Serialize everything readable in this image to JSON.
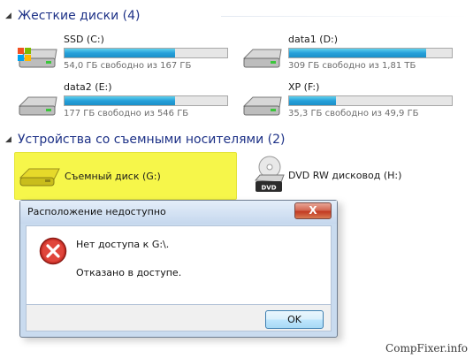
{
  "hard_drives_group": {
    "title": "Жесткие диски (4)",
    "drives": [
      {
        "name": "SSD (C:)",
        "free_text": "54,0 ГБ свободно из 167 ГБ",
        "used_fraction": 0.68
      },
      {
        "name": "data1 (D:)",
        "free_text": "309 ГБ свободно из 1,81 ТБ",
        "used_fraction": 0.84
      },
      {
        "name": "data2 (E:)",
        "free_text": "177 ГБ свободно из 546 ГБ",
        "used_fraction": 0.68
      },
      {
        "name": "XP (F:)",
        "free_text": "35,3 ГБ свободно из 49,9 ГБ",
        "used_fraction": 0.29
      }
    ]
  },
  "removable_group": {
    "title": "Устройства со съемными носителями (2)",
    "devices": [
      {
        "name": "Съемный диск (G:)"
      },
      {
        "name": "DVD RW дисковод (H:)",
        "badge": "DVD"
      }
    ]
  },
  "dialog": {
    "title": "Расположение недоступно",
    "close_label": "X",
    "message": "Нет доступа к G:\\.",
    "detail": "Отказано в доступе.",
    "ok_label": "OK"
  },
  "watermark": "CompFixer.info",
  "colors": {
    "group_header": "#1e3287",
    "bar_fill": "#26a0da",
    "highlight": "#f6f64a",
    "error_red": "#c8281e"
  }
}
